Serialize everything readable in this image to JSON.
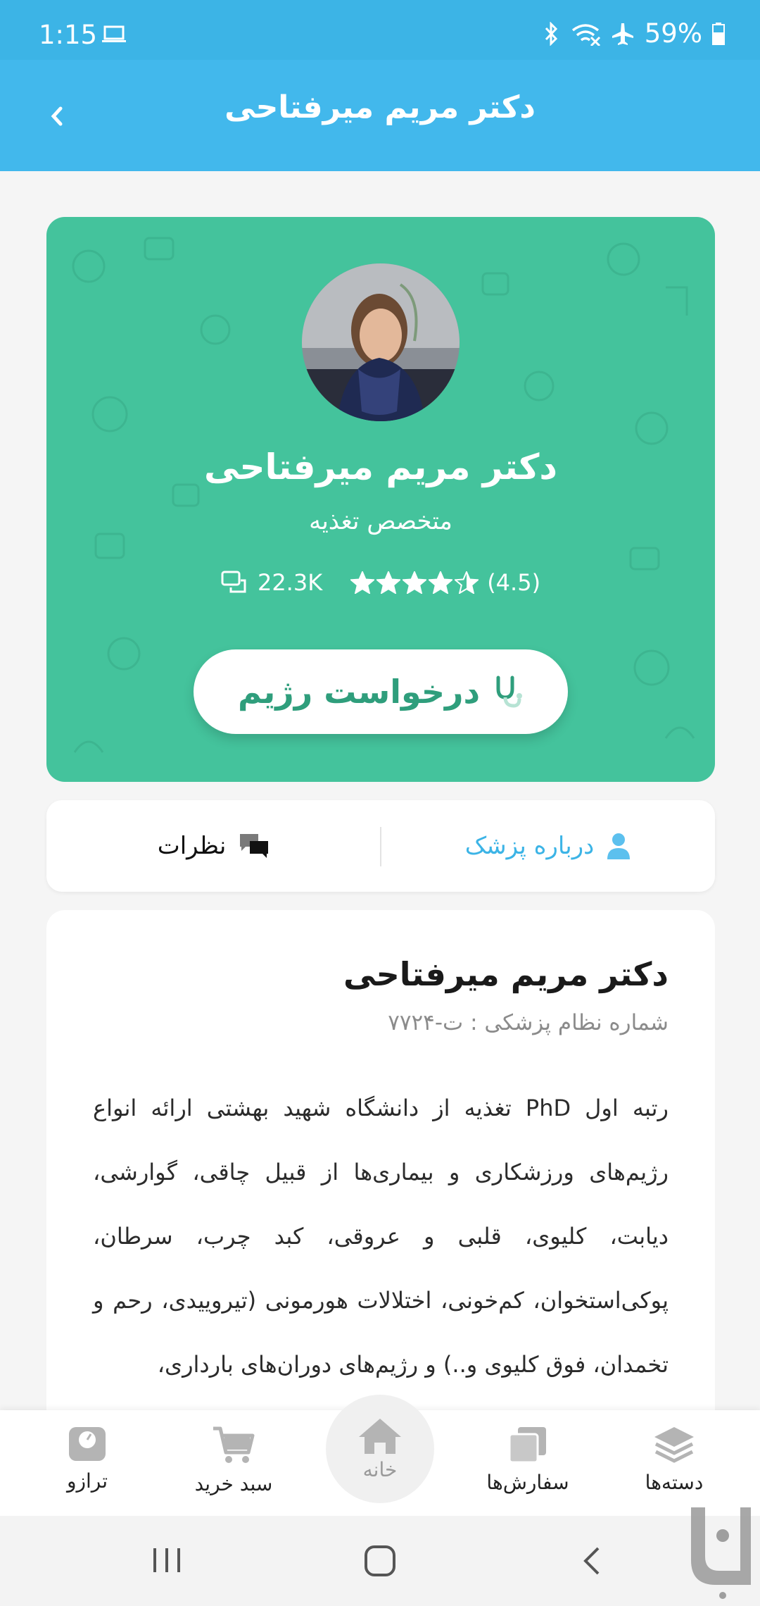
{
  "status_bar": {
    "time": "1:15",
    "battery": "59%"
  },
  "header": {
    "title": "دکتر مریم میرفتاحی"
  },
  "profile": {
    "name": "دکتر مریم میرفتاحی",
    "specialty": "متخصص تغذیه",
    "comments_count": "22.3K",
    "rating_text": "(4.5)",
    "rating_value": 4.5,
    "request_button_label": "درخواست رژیم"
  },
  "tabs": {
    "about": "درباره پزشک",
    "comments": "نظرات"
  },
  "about": {
    "name": "دکتر مریم میرفتاحی",
    "license": "شماره نظام پزشکی : ت-۷۷۲۴",
    "bio": "رتبه اول PhD تغذیه از دانشگاه شهید بهشتی ارائه انواع رژیم‌های ورزشکاری و بیماری‌ها از قبیل چاقی، گوارشی، دیابت، کلیوی، قلبی و عروقی، کبد چرب، سرطان، پوکی‌استخوان، کم‌خونی، اختلالات هورمونی (تیروییدی، رحم و تخمدان، فوق کلیوی و..) و رژیم‌های دوران‌های بارداری،"
  },
  "bottom_nav": {
    "scale": "ترازو",
    "cart": "سبد خرید",
    "home": "خانه",
    "orders": "سفارش‌ها",
    "categories": "دسته‌ها"
  },
  "colors": {
    "status_bar": "#3cb4e6",
    "app_bar": "#42b8ec",
    "card_green": "#44c39c",
    "accent_green": "#2f9e7c",
    "accent_blue": "#3cb4e6"
  }
}
